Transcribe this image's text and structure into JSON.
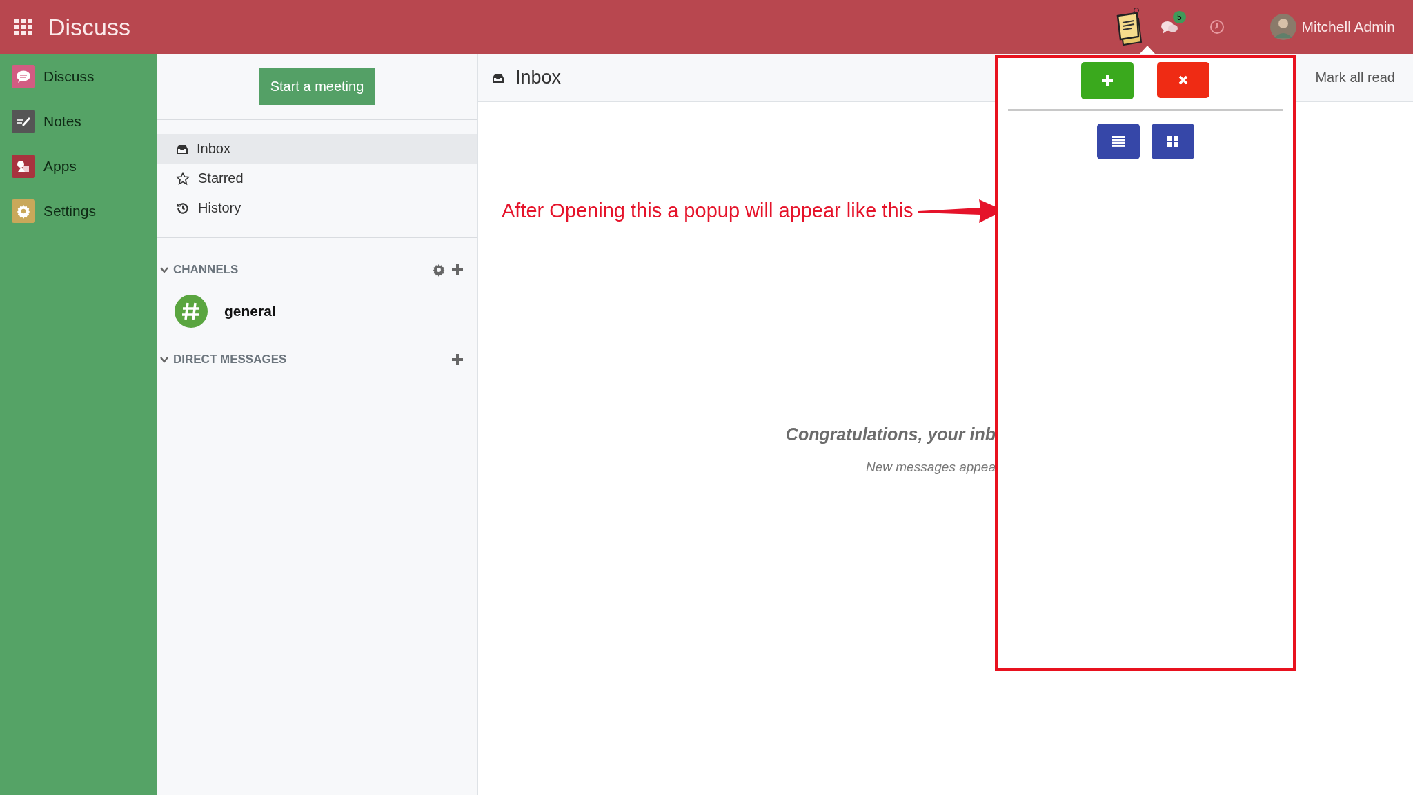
{
  "topbar": {
    "app_title": "Discuss",
    "message_count": "5",
    "user_name": "Mitchell Admin"
  },
  "sidebar": {
    "items": [
      {
        "label": "Discuss",
        "kind": "chat"
      },
      {
        "label": "Notes",
        "kind": "notes"
      },
      {
        "label": "Apps",
        "kind": "apps"
      },
      {
        "label": "Settings",
        "kind": "settings"
      }
    ]
  },
  "panel": {
    "start_button": "Start a meeting",
    "mailboxes": [
      {
        "label": "Inbox",
        "kind": "inbox",
        "selected": true
      },
      {
        "label": "Starred",
        "kind": "star",
        "selected": false
      },
      {
        "label": "History",
        "kind": "history",
        "selected": false
      }
    ],
    "sections": [
      {
        "title": "CHANNELS",
        "expanded": true,
        "has_settings": true,
        "has_add": true,
        "channels": [
          {
            "name": "general"
          }
        ]
      },
      {
        "title": "DIRECT MESSAGES",
        "expanded": true,
        "has_settings": false,
        "has_add": true
      }
    ]
  },
  "main": {
    "title": "Inbox",
    "mark_all_read": "Mark all read",
    "empty_title": "Congratulations, your inb",
    "empty_subtitle": "New messages appea"
  },
  "annotation": {
    "text": "After Opening this a popup will appear like this"
  },
  "popup": {
    "top_buttons": [
      {
        "kind": "add"
      },
      {
        "kind": "close"
      }
    ],
    "view_buttons": [
      {
        "kind": "list"
      },
      {
        "kind": "grid"
      }
    ]
  }
}
